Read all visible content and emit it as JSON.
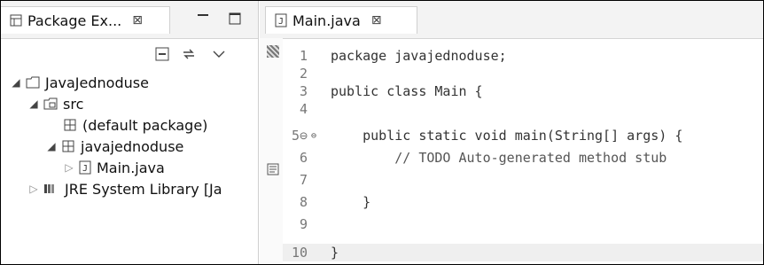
{
  "left_panel": {
    "tab": {
      "title": "Package Ex...",
      "close_symbol": "⊠"
    },
    "tree": [
      {
        "label": "JavaJednoduse",
        "icon": "project-folder-icon",
        "expanded": true
      },
      {
        "label": "src",
        "icon": "source-folder-icon",
        "expanded": true
      },
      {
        "label": "(default package)",
        "icon": "package-icon",
        "expanded": null
      },
      {
        "label": "javajednoduse",
        "icon": "package-icon",
        "expanded": true
      },
      {
        "label": "Main.java",
        "icon": "java-file-icon",
        "expanded": false
      },
      {
        "label": "JRE System Library [Ja",
        "icon": "library-icon",
        "expanded": false
      }
    ]
  },
  "editor": {
    "tab": {
      "title": "Main.java",
      "close_symbol": "⊠"
    },
    "lines": [
      {
        "n": "1",
        "text": "package javajednoduse;"
      },
      {
        "n": "2",
        "text": ""
      },
      {
        "n": "3",
        "text": "public class Main {"
      },
      {
        "n": "4",
        "text": ""
      },
      {
        "n": "5⊖",
        "text": "    public static void main(String[] args) {"
      },
      {
        "n": "6",
        "text": "        // TODO Auto-generated method stub"
      },
      {
        "n": "7",
        "text": ""
      },
      {
        "n": "8",
        "text": "    }"
      },
      {
        "n": "9",
        "text": ""
      },
      {
        "n": "10",
        "text": "}"
      }
    ]
  },
  "colors": {
    "tabbar": "#f3f3f3",
    "border": "#d0d0d0",
    "current_line": "#efefef"
  }
}
